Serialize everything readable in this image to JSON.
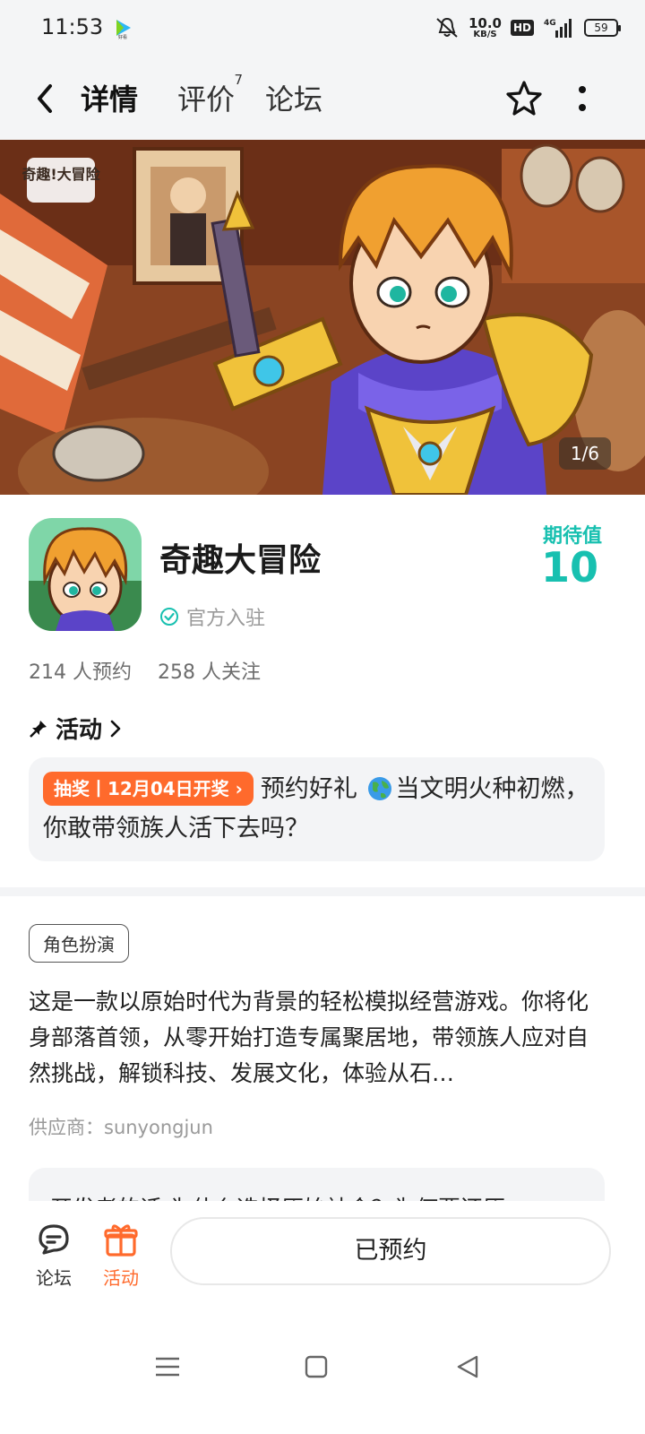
{
  "status_bar": {
    "time": "11:53",
    "net_speed_value": "10.0",
    "net_speed_unit": "KB/S",
    "hd_label": "HD",
    "network": "4G",
    "battery": "59"
  },
  "header": {
    "tabs": [
      {
        "label": "详情",
        "active": true
      },
      {
        "label": "评价",
        "badge": "7"
      },
      {
        "label": "论坛"
      }
    ]
  },
  "banner": {
    "counter": "1/6",
    "logo_text": "奇趣!大冒险"
  },
  "game": {
    "title": "奇趣大冒险",
    "official_label": "官方入驻",
    "expectation_label": "期待值",
    "expectation_value": "10",
    "reservations": "214 人预约",
    "followers": "258 人关注"
  },
  "activity": {
    "heading": "活动",
    "tag": "抽奖丨12月04日开奖",
    "text_before_icon": "预约好礼",
    "text_after_icon": "当文明火种初燃，你敢带领族人活下去吗？"
  },
  "details": {
    "genre_tag": "角色扮演",
    "description": "这是一款以原始时代为背景的轻松模拟经营游戏。你将化身部落首领，从零开始打造专属聚居地，带领族人应对自然挑战，解锁科技、发展文化，体验从石…",
    "supplier": "供应商：sunyongjun",
    "dev_note": "开发者的话  为什么选择原始社会？为何要还原"
  },
  "bottom_bar": {
    "forum_label": "论坛",
    "activity_label": "活动",
    "reserve_label": "已预约"
  },
  "colors": {
    "accent": "#18c7b8",
    "orange": "#ff6a2c"
  }
}
